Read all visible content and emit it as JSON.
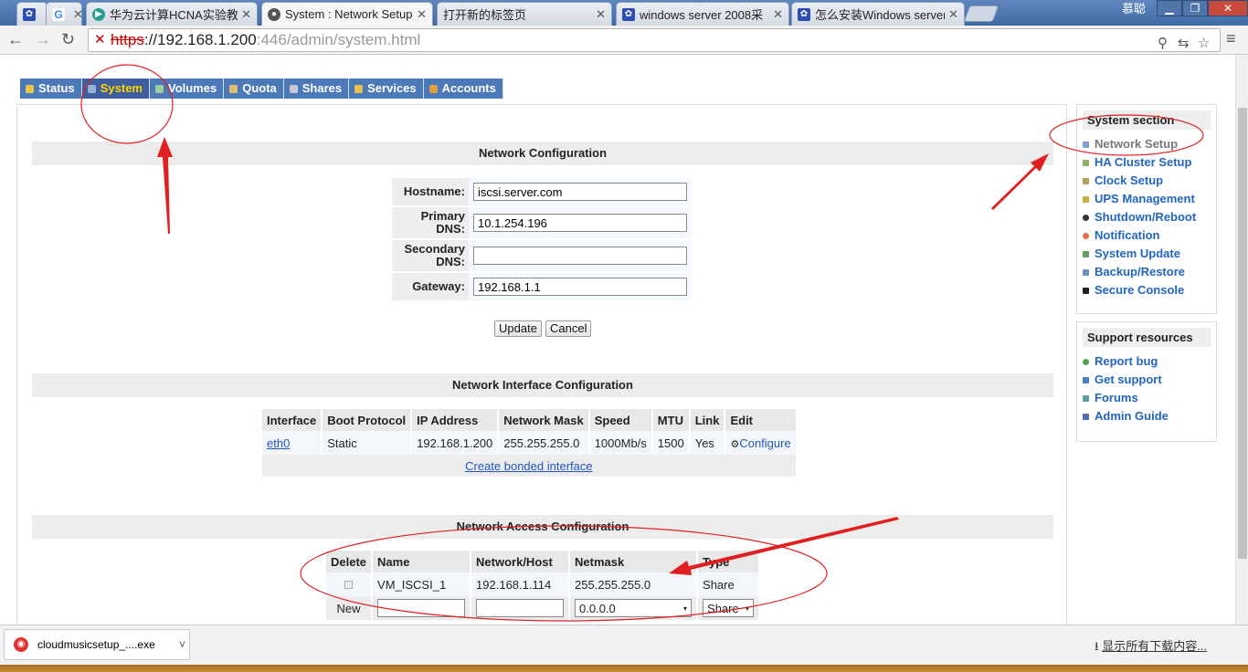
{
  "browser": {
    "tabs": [
      {
        "label": "",
        "icon": "paw-icon",
        "active": false
      },
      {
        "label": "",
        "icon": "google-icon",
        "active": false
      },
      {
        "label": "华为云计算HCNA实验教",
        "icon": "play-icon",
        "active": false
      },
      {
        "label": "System : Network Setup",
        "icon": "page-icon",
        "active": true
      },
      {
        "label": "打开新的标签页",
        "icon": "",
        "active": false
      },
      {
        "label": "windows server 2008采",
        "icon": "paw-icon",
        "active": false
      },
      {
        "label": "怎么安装Windows server",
        "icon": "paw-icon",
        "active": false
      }
    ],
    "user_name": "慕聪",
    "url_scheme": "https",
    "url_host": "://192.168.1.200",
    "url_rest": ":446/admin/system.html"
  },
  "nav": {
    "tabs": [
      {
        "label": "Status",
        "active": false
      },
      {
        "label": "System",
        "active": true
      },
      {
        "label": "Volumes",
        "active": false
      },
      {
        "label": "Quota",
        "active": false
      },
      {
        "label": "Shares",
        "active": false
      },
      {
        "label": "Services",
        "active": false
      },
      {
        "label": "Accounts",
        "active": false
      }
    ]
  },
  "network_config": {
    "title": "Network Configuration",
    "hostname_label": "Hostname:",
    "hostname_value": "iscsi.server.com",
    "primary_dns_label": "Primary DNS:",
    "primary_dns_value": "10.1.254.196",
    "secondary_dns_label": "Secondary DNS:",
    "secondary_dns_value": "",
    "gateway_label": "Gateway:",
    "gateway_value": "192.168.1.1",
    "update_label": "Update",
    "cancel_label": "Cancel"
  },
  "interface_config": {
    "title": "Network Interface Configuration",
    "headers": [
      "Interface",
      "Boot Protocol",
      "IP Address",
      "Network Mask",
      "Speed",
      "MTU",
      "Link",
      "Edit"
    ],
    "rows": [
      {
        "interface": "eth0",
        "boot": "Static",
        "ip": "192.168.1.200",
        "mask": "255.255.255.0",
        "speed": "1000Mb/s",
        "mtu": "1500",
        "link": "Yes",
        "edit": "Configure"
      }
    ],
    "bonded_link": "Create bonded interface"
  },
  "access_config": {
    "title": "Network Access Configuration",
    "headers": [
      "Delete",
      "Name",
      "Network/Host",
      "Netmask",
      "Type"
    ],
    "rows": [
      {
        "name": "VM_ISCSI_1",
        "host": "192.168.1.114",
        "mask": "255.255.255.0",
        "type": "Share"
      }
    ],
    "new_label": "New",
    "new_netmask": "0.0.0.0",
    "new_type": "Share"
  },
  "sidebar": {
    "system_title": "System section",
    "system_items": [
      {
        "label": "Network Setup",
        "color": "#7fa0d0",
        "current": true
      },
      {
        "label": "HA Cluster Setup",
        "color": "#8fb06a",
        "current": false
      },
      {
        "label": "Clock Setup",
        "color": "#b0a060",
        "current": false
      },
      {
        "label": "UPS Management",
        "color": "#c8b040",
        "current": false
      },
      {
        "label": "Shutdown/Reboot",
        "color": "#333333",
        "current": false
      },
      {
        "label": "Notification",
        "color": "#e07050",
        "current": false
      },
      {
        "label": "System Update",
        "color": "#60a060",
        "current": false
      },
      {
        "label": "Backup/Restore",
        "color": "#7090c0",
        "current": false
      },
      {
        "label": "Secure Console",
        "color": "#222222",
        "current": false
      }
    ],
    "support_title": "Support resources",
    "support_items": [
      {
        "label": "Report bug",
        "color": "#50a050"
      },
      {
        "label": "Get support",
        "color": "#5080c0"
      },
      {
        "label": "Forums",
        "color": "#60a0a0"
      },
      {
        "label": "Admin Guide",
        "color": "#5070b0"
      }
    ]
  },
  "downloads": {
    "file_name": "cloudmusicsetup_....exe",
    "show_all": "显示所有下载内容..."
  }
}
